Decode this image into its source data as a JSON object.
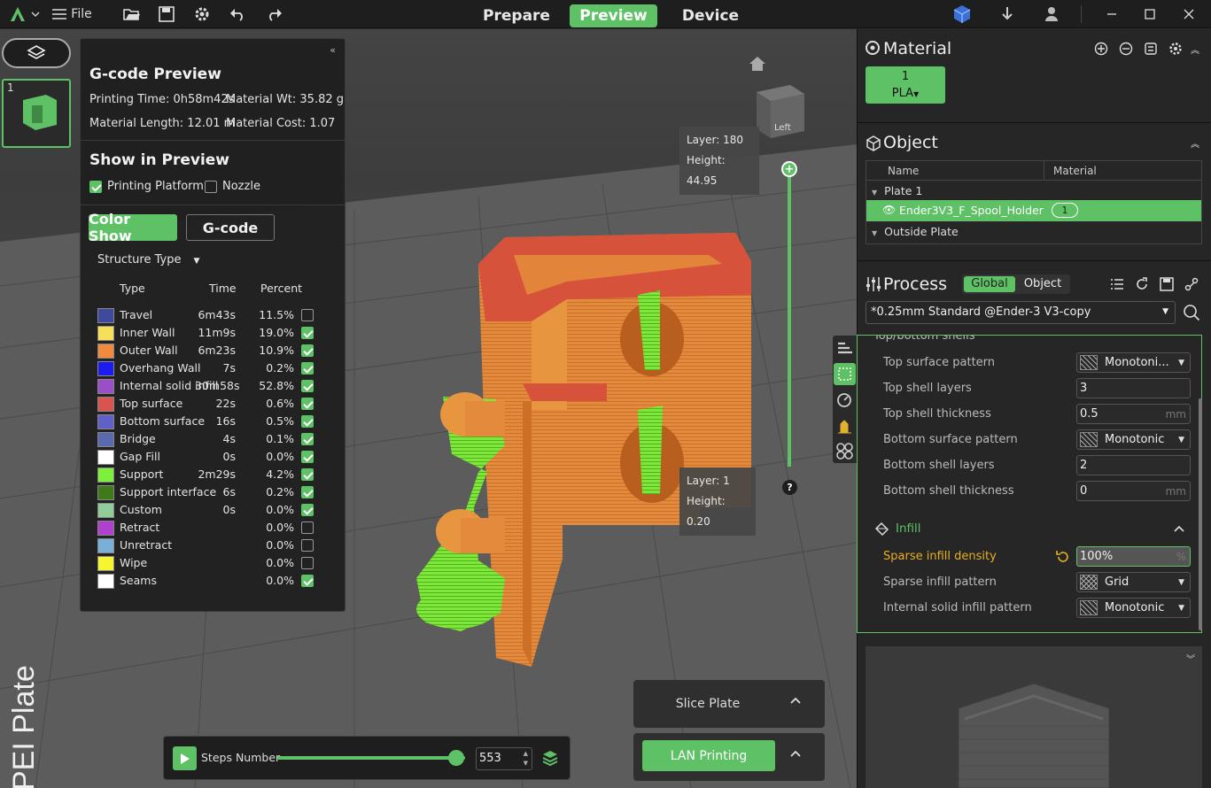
{
  "topbar": {
    "file_label": "File",
    "tabs": [
      "Prepare",
      "Preview",
      "Device"
    ],
    "active_tab": "Preview"
  },
  "plate_thumb_index": "1",
  "gcode_preview": {
    "title": "G-code Preview",
    "printing_time": "Printing Time: 0h58m42s",
    "material_wt": "Material Wt: 35.82 g",
    "material_length": "Material Length: 12.01 m",
    "material_cost": "Material Cost: 1.07",
    "show_title": "Show in Preview",
    "printing_platform": "Printing Platform",
    "nozzle": "Nozzle",
    "color_show": "Color Show",
    "gcode": "G-code",
    "structure_type": "Structure Type",
    "col_type": "Type",
    "col_time": "Time",
    "col_percent": "Percent",
    "rows": [
      {
        "name": "Travel",
        "time": "6m43s",
        "percent": "11.5%",
        "color": "#3f4a9c",
        "checked": false
      },
      {
        "name": "Inner Wall",
        "time": "11m9s",
        "percent": "19.0%",
        "color": "#f5e05a",
        "checked": true
      },
      {
        "name": "Outer Wall",
        "time": "6m23s",
        "percent": "10.9%",
        "color": "#f08a3c",
        "checked": true
      },
      {
        "name": "Overhang Wall",
        "time": "7s",
        "percent": "0.2%",
        "color": "#1c1cf0",
        "checked": true
      },
      {
        "name": "Internal solid infill",
        "time": "30m58s",
        "percent": "52.8%",
        "color": "#9a4fc9",
        "checked": true
      },
      {
        "name": "Top surface",
        "time": "22s",
        "percent": "0.6%",
        "color": "#d9534f",
        "checked": true
      },
      {
        "name": "Bottom surface",
        "time": "16s",
        "percent": "0.5%",
        "color": "#6060c8",
        "checked": true
      },
      {
        "name": "Bridge",
        "time": "4s",
        "percent": "0.1%",
        "color": "#5a6aae",
        "checked": true
      },
      {
        "name": "Gap Fill",
        "time": "0s",
        "percent": "0.0%",
        "color": "#ffffff",
        "checked": true
      },
      {
        "name": "Support",
        "time": "2m29s",
        "percent": "4.2%",
        "color": "#7cf03a",
        "checked": true
      },
      {
        "name": "Support interface",
        "time": "6s",
        "percent": "0.2%",
        "color": "#3e7a1a",
        "checked": true
      },
      {
        "name": "Custom",
        "time": "0s",
        "percent": "0.0%",
        "color": "#8fcc9a",
        "checked": true
      },
      {
        "name": "Retract",
        "time": "",
        "percent": "0.0%",
        "color": "#b040d0",
        "checked": false
      },
      {
        "name": "Unretract",
        "time": "",
        "percent": "0.0%",
        "color": "#7ab0d8",
        "checked": false
      },
      {
        "name": "Wipe",
        "time": "",
        "percent": "0.0%",
        "color": "#f5f530",
        "checked": false
      },
      {
        "name": "Seams",
        "time": "",
        "percent": "0.0%",
        "color": "#ffffff",
        "checked": true
      }
    ]
  },
  "layer_top": {
    "layer": "Layer: 180",
    "height": "Height: 44.95"
  },
  "layer_bottom": {
    "layer": "Layer: 1",
    "height": "Height: 0.20"
  },
  "cube_label": "Left",
  "bed_text": "PEI Plate",
  "steps": {
    "label": "Steps Number",
    "value": "553",
    "progress": 1.0
  },
  "slice_plate": "Slice Plate",
  "lan_printing": "LAN Printing",
  "material": {
    "title": "Material",
    "slot": "1",
    "type": "PLA"
  },
  "object": {
    "title": "Object",
    "col_name": "Name",
    "col_material": "Material",
    "plate": "Plate 1",
    "item": "Ender3V3_F_Spool_Holder",
    "item_material": "1",
    "outside": "Outside Plate"
  },
  "process": {
    "title": "Process",
    "global": "Global",
    "object": "Object",
    "preset": "*0.25mm Standard @Ender-3 V3-copy",
    "partial_heading": "Top/bottom shells",
    "top_surface_pattern": {
      "label": "Top surface pattern",
      "value": "Monotoni..."
    },
    "top_shell_layers": {
      "label": "Top shell layers",
      "value": "3"
    },
    "top_shell_thickness": {
      "label": "Top shell thickness",
      "value": "0.5",
      "unit": "mm"
    },
    "bottom_surface_pattern": {
      "label": "Bottom surface pattern",
      "value": "Monotonic"
    },
    "bottom_shell_layers": {
      "label": "Bottom shell layers",
      "value": "2"
    },
    "bottom_shell_thickness": {
      "label": "Bottom shell thickness",
      "value": "0",
      "unit": "mm"
    },
    "infill": "Infill",
    "sparse_density": {
      "label": "Sparse infill density",
      "value": "100%",
      "unit": "%"
    },
    "sparse_pattern": {
      "label": "Sparse infill pattern",
      "value": "Grid"
    },
    "internal_pattern": {
      "label": "Internal solid infill pattern",
      "value": "Monotonic"
    }
  }
}
